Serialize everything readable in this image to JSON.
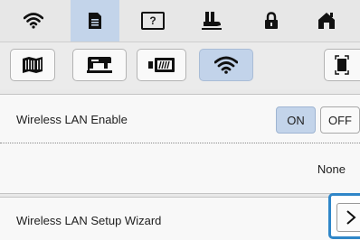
{
  "tabs": [
    {
      "icon": "wifi-icon",
      "active": false
    },
    {
      "icon": "document-icon",
      "active": true
    },
    {
      "icon": "help-box-icon",
      "label": "?",
      "active": false
    },
    {
      "icon": "sewing-foot-icon",
      "active": false
    },
    {
      "icon": "lock-icon",
      "active": false
    },
    {
      "icon": "home-icon",
      "active": false
    }
  ],
  "subtabs": [
    {
      "icon": "fabric-icon",
      "active": false
    },
    {
      "icon": "sewing-machine-icon",
      "active": false
    },
    {
      "icon": "pattern-feed-icon",
      "label": "/////",
      "active": false
    },
    {
      "icon": "wifi-icon",
      "active": true
    },
    {
      "icon": "screen-frame-icon",
      "active": false
    }
  ],
  "wireless_lan": {
    "label": "Wireless LAN Enable",
    "on_label": "ON",
    "off_label": "OFF",
    "state": "ON"
  },
  "network": {
    "value": "None"
  },
  "setup_wizard": {
    "label": "Wireless LAN Setup Wizard",
    "arrow": "chevron-right-icon"
  },
  "colors": {
    "accent": "#c3d4ea",
    "focus_outline": "#2f86c8"
  }
}
